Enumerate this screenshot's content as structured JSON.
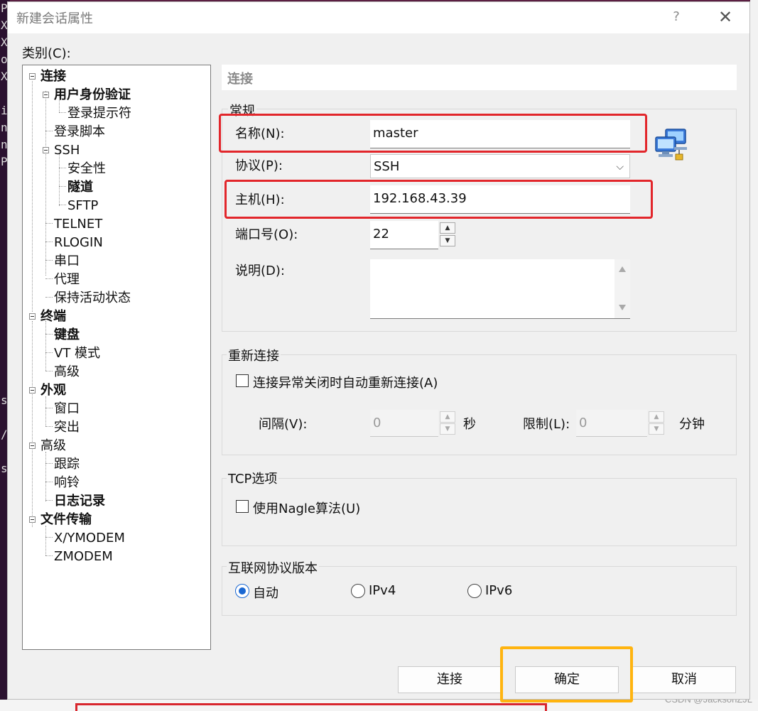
{
  "window": {
    "title": "新建会话属性",
    "help_label": "?",
    "close_label": "✕"
  },
  "category_label": "类别(C):",
  "tree": [
    {
      "label": "连接",
      "bold": true
    },
    {
      "label": "用户身份验证",
      "bold": true
    },
    {
      "label": "登录提示符",
      "bold": false
    },
    {
      "label": "登录脚本",
      "bold": false
    },
    {
      "label": "SSH",
      "bold": false
    },
    {
      "label": "安全性",
      "bold": false
    },
    {
      "label": "隧道",
      "bold": true
    },
    {
      "label": "SFTP",
      "bold": false
    },
    {
      "label": "TELNET",
      "bold": false
    },
    {
      "label": "RLOGIN",
      "bold": false
    },
    {
      "label": "串口",
      "bold": false
    },
    {
      "label": "代理",
      "bold": false
    },
    {
      "label": "保持活动状态",
      "bold": false
    },
    {
      "label": "终端",
      "bold": true
    },
    {
      "label": "键盘",
      "bold": true
    },
    {
      "label": "VT 模式",
      "bold": false
    },
    {
      "label": "高级",
      "bold": false
    },
    {
      "label": "外观",
      "bold": true
    },
    {
      "label": "窗口",
      "bold": false
    },
    {
      "label": "突出",
      "bold": false
    },
    {
      "label": "高级",
      "bold": false
    },
    {
      "label": "跟踪",
      "bold": false
    },
    {
      "label": "响铃",
      "bold": false
    },
    {
      "label": "日志记录",
      "bold": true
    },
    {
      "label": "文件传输",
      "bold": true
    },
    {
      "label": "X/YMODEM",
      "bold": false
    },
    {
      "label": "ZMODEM",
      "bold": false
    }
  ],
  "panel": {
    "header": "连接"
  },
  "general": {
    "title": "常规",
    "name_label": "名称(N):",
    "name_value": "master",
    "protocol_label": "协议(P):",
    "protocol_value": "SSH",
    "host_label": "主机(H):",
    "host_value": "192.168.43.39",
    "port_label": "端口号(O):",
    "port_value": "22",
    "desc_label": "说明(D):",
    "desc_value": ""
  },
  "reconnect": {
    "title": "重新连接",
    "auto_label": "连接异常关闭时自动重新连接(A)",
    "interval_label": "间隔(V):",
    "interval_value": "0",
    "interval_unit": "秒",
    "limit_label": "限制(L):",
    "limit_value": "0",
    "limit_unit": "分钟"
  },
  "tcp": {
    "title": "TCP选项",
    "nagle_label": "使用Nagle算法(U)"
  },
  "ipver": {
    "title": "互联网协议版本",
    "auto": "自动",
    "ipv4": "IPv4",
    "ipv6": "IPv6",
    "selected": "自动"
  },
  "buttons": {
    "connect": "连接",
    "ok": "确定",
    "cancel": "取消"
  },
  "background": {
    "strip_chars": [
      "P",
      "X",
      "X",
      "o",
      "X",
      "",
      "i",
      "n",
      "n",
      "P",
      "",
      "",
      "",
      "",
      "",
      "",
      "",
      "",
      "",
      "",
      "",
      "",
      "",
      "s",
      "",
      "/",
      "",
      "st"
    ],
    "watermark": "CSDN @JacksonZJL"
  },
  "highlight_colors": {
    "red": "#e2262b",
    "yellow": "#ffb40f",
    "radio_accent": "#1967d2"
  }
}
